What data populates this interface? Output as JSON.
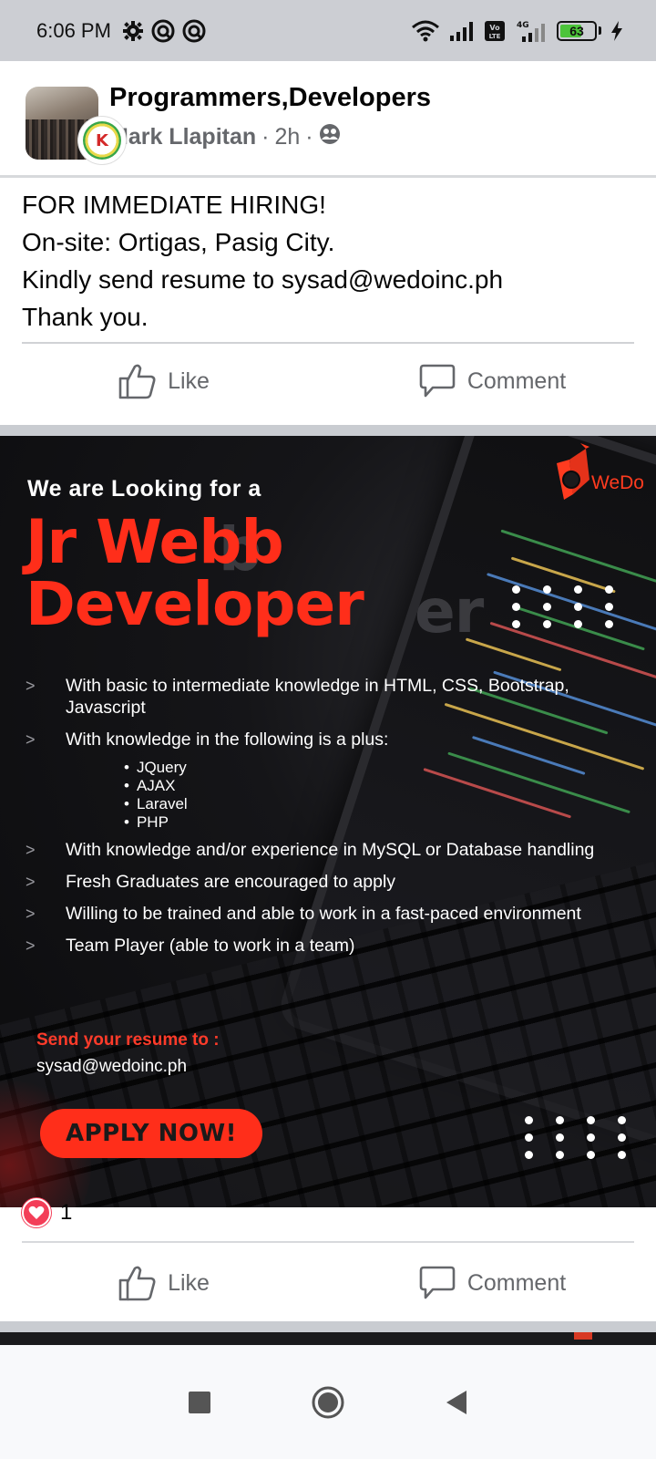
{
  "status_bar": {
    "time": "6:06 PM",
    "battery_level": "63",
    "network_label": "4G",
    "volte_label": "Vo LTE"
  },
  "post": {
    "group_name": "Programmers,Developers",
    "author": "Mark Llapitan",
    "time_ago": "2h",
    "separator": "·",
    "text_lines": [
      "FOR IMMEDIATE HIRING!",
      "On-site: Ortigas, Pasig City.",
      "Kindly send resume to sysad@wedoinc.ph",
      "Thank you."
    ]
  },
  "actions": {
    "like_label": "Like",
    "comment_label": "Comment"
  },
  "image": {
    "logo_text": "WeDo",
    "headline": "We are Looking for a",
    "title_line1": "Jr Webb",
    "title_line2": "Developer",
    "requirements": [
      "With basic to intermediate knowledge in HTML, CSS, Bootstrap, Javascript",
      "With knowledge in the following is a plus:",
      "With knowledge and/or experience in MySQL or Database handling",
      "Fresh Graduates are encouraged to apply",
      "Willing to be trained and able to work in a fast-paced environment",
      "Team Player (able to work in a team)"
    ],
    "plus_skills": [
      "JQuery",
      "AJAX",
      "Laravel",
      "PHP"
    ],
    "send_label": "Send your resume to :",
    "send_email": "sysad@wedoinc.ph",
    "apply_label": "APPLY NOW!"
  },
  "reactions": {
    "count": "1",
    "type_icon": "heart-icon"
  },
  "colors": {
    "accent_red": "#ff2e1a",
    "meta_gray": "#65676b",
    "status_bar_bg": "#ccced3",
    "heart": "#f33e58"
  }
}
